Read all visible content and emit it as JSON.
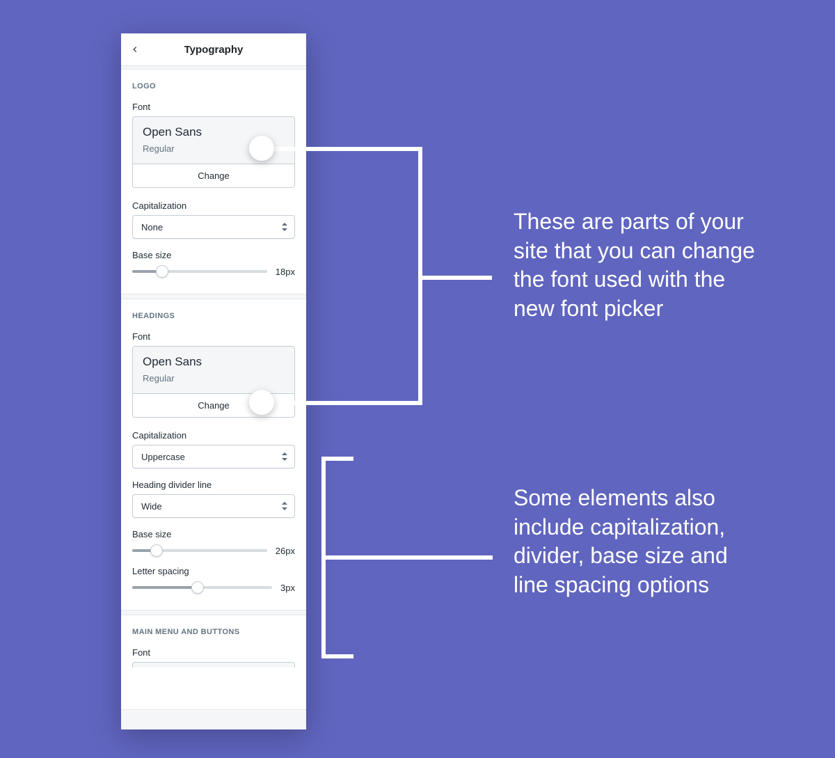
{
  "panel": {
    "title": "Typography",
    "sections": {
      "logo": {
        "title": "LOGO",
        "font_label": "Font",
        "font_name": "Open Sans",
        "font_weight": "Regular",
        "change_label": "Change",
        "cap_label": "Capitalization",
        "cap_value": "None",
        "base_size_label": "Base size",
        "base_size_value": "18px",
        "base_size_pct": 22
      },
      "headings": {
        "title": "HEADINGS",
        "font_label": "Font",
        "font_name": "Open Sans",
        "font_weight": "Regular",
        "change_label": "Change",
        "cap_label": "Capitalization",
        "cap_value": "Uppercase",
        "divider_label": "Heading divider line",
        "divider_value": "Wide",
        "base_size_label": "Base size",
        "base_size_value": "26px",
        "base_size_pct": 18,
        "letter_spacing_label": "Letter spacing",
        "letter_spacing_value": "3px",
        "letter_spacing_pct": 47
      },
      "mainmenu": {
        "title": "MAIN MENU AND BUTTONS",
        "font_label": "Font"
      }
    }
  },
  "annotations": {
    "top": "These are parts of your site that you can change the font used with the new font picker",
    "bottom": "Some elements also include capitalization, divider, base size and line spacing options"
  }
}
